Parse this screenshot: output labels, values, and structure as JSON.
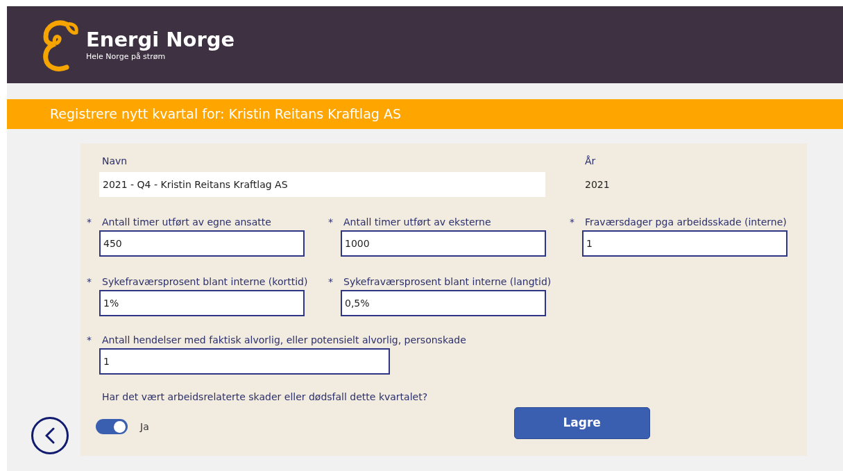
{
  "header": {
    "logo_title": "Energi Norge",
    "logo_tagline": "Hele Norge på strøm"
  },
  "title_bar": "Registrere nytt kvartal for: Kristin Reitans Kraftlag AS",
  "form": {
    "name_field": {
      "label": "Navn",
      "value": "2021 - Q4 - Kristin Reitans Kraftlag AS"
    },
    "year": {
      "label": "År",
      "value": "2021"
    },
    "rows": [
      [
        {
          "marker": "*",
          "label": "Antall timer utført av egne ansatte",
          "value": "450"
        },
        {
          "marker": "*",
          "label": "Antall timer utført av eksterne",
          "value": "1000"
        },
        {
          "marker": "*",
          "label": "Fraværsdager pga arbeidsskade (interne)",
          "value": "1"
        }
      ],
      [
        {
          "marker": "*",
          "label": "Sykefraværsprosent blant interne (korttid)",
          "value": "1%"
        },
        {
          "marker": "*",
          "label": "Sykefraværsprosent blant interne (langtid)",
          "value": "0,5%"
        }
      ],
      [
        {
          "marker": "*",
          "label": "Antall hendelser med faktisk alvorlig, eller potensielt alvorlig, personskade",
          "value": "1"
        }
      ]
    ],
    "question": "Har det vært arbeidsrelaterte skader eller dødsfall dette kvartalet?",
    "toggle": {
      "label": "Ja",
      "on": true
    },
    "save_button": "Lagre"
  }
}
